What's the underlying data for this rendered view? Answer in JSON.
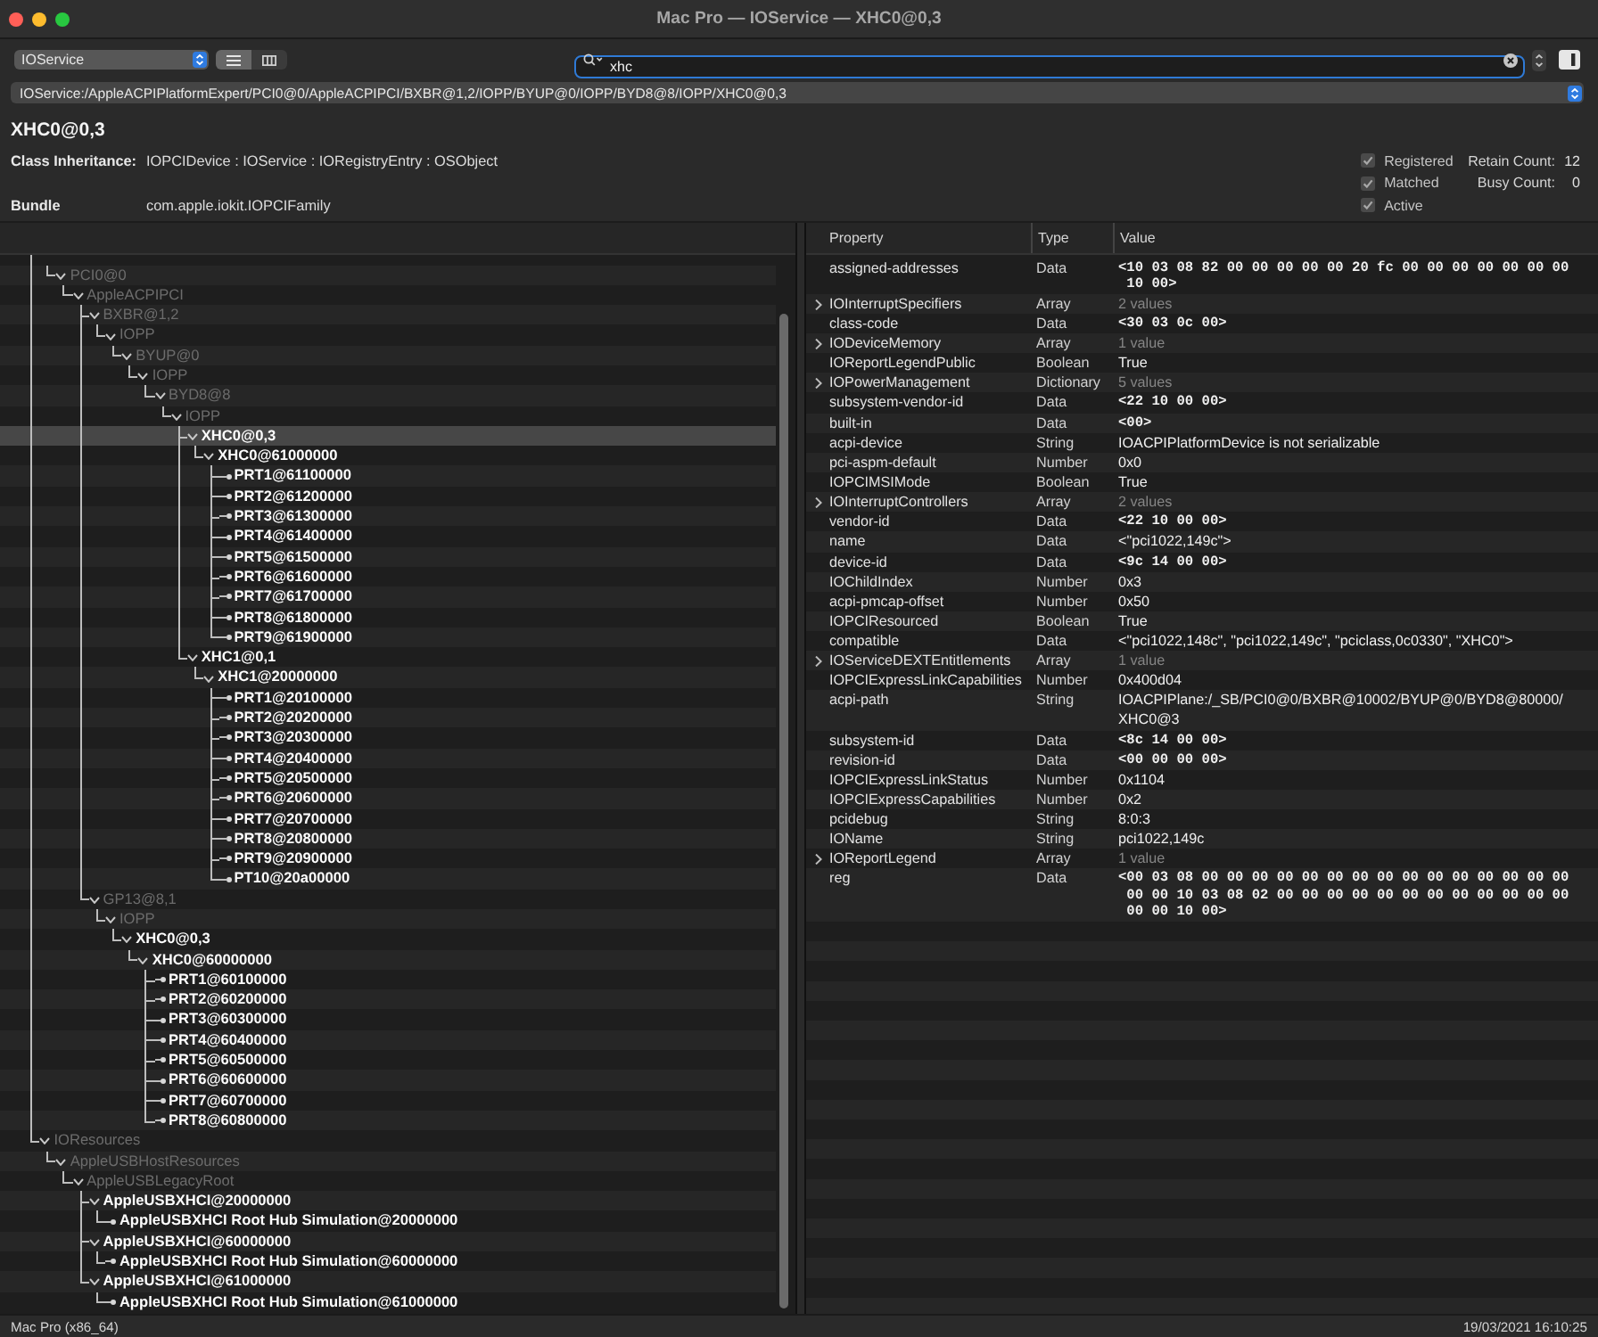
{
  "window": {
    "title": "Mac Pro — IOService — XHC0@0,3"
  },
  "toolbar": {
    "plane_popup": {
      "value": "IOService"
    },
    "view_modes": [
      {
        "kind": "list",
        "selected": true
      },
      {
        "kind": "columns",
        "selected": false
      }
    ],
    "search": {
      "value": "xhc",
      "focused": true
    }
  },
  "path_popup": {
    "value": "IOService:/AppleACPIPlatformExpert/PCI0@0/AppleACPIPCI/BXBR@1,2/IOPP/BYUP@0/IOPP/BYD8@8/IOPP/XHC0@0,3"
  },
  "object": {
    "name": "XHC0@0,3",
    "fields": [
      {
        "label": "Class Inheritance:",
        "value": "IOPCIDevice : IOService : IORegistryEntry : OSObject"
      },
      {
        "label": "Bundle",
        "value": "com.apple.iokit.IOPCIFamily"
      }
    ],
    "flags": [
      {
        "label": "Registered",
        "checked": true,
        "disabled": true
      },
      {
        "label": "Matched",
        "checked": true,
        "disabled": true
      },
      {
        "label": "Active",
        "checked": true,
        "disabled": true
      }
    ],
    "counts": [
      {
        "label": "Retain Count:",
        "value": "12"
      },
      {
        "label": "Busy Count:",
        "value": "0"
      }
    ]
  },
  "tree": {
    "nodes": [
      {
        "children": [
          {
            "label": "PCI0@0",
            "matched": false,
            "selected": false,
            "expanded": true,
            "children": [
              {
                "label": "AppleACPIPCI",
                "matched": false,
                "selected": false,
                "expanded": true,
                "children": [
                  {
                    "label": "BXBR@1,2",
                    "matched": false,
                    "selected": false,
                    "expanded": true,
                    "children": [
                      {
                        "label": "IOPP",
                        "matched": false,
                        "selected": false,
                        "expanded": true,
                        "children": [
                          {
                            "label": "BYUP@0",
                            "matched": false,
                            "selected": false,
                            "expanded": true,
                            "children": [
                              {
                                "label": "IOPP",
                                "matched": false,
                                "selected": false,
                                "expanded": true,
                                "children": [
                                  {
                                    "label": "BYD8@8",
                                    "matched": false,
                                    "selected": false,
                                    "expanded": true,
                                    "children": [
                                      {
                                        "label": "IOPP",
                                        "matched": false,
                                        "selected": false,
                                        "expanded": true,
                                        "children": [
                                          {
                                            "label": "XHC0@0,3",
                                            "matched": true,
                                            "selected": true,
                                            "expanded": true,
                                            "children": [
                                              {
                                                "label": "XHC0@61000000",
                                                "matched": true,
                                                "selected": false,
                                                "expanded": true,
                                                "children": [
                                                  {
                                                    "label": "PRT1@61100000",
                                                    "matched": true,
                                                    "selected": false
                                                  },
                                                  {
                                                    "label": "PRT2@61200000",
                                                    "matched": true,
                                                    "selected": false
                                                  },
                                                  {
                                                    "label": "PRT3@61300000",
                                                    "matched": true,
                                                    "selected": false
                                                  },
                                                  {
                                                    "label": "PRT4@61400000",
                                                    "matched": true,
                                                    "selected": false
                                                  },
                                                  {
                                                    "label": "PRT5@61500000",
                                                    "matched": true,
                                                    "selected": false
                                                  },
                                                  {
                                                    "label": "PRT6@61600000",
                                                    "matched": true,
                                                    "selected": false
                                                  },
                                                  {
                                                    "label": "PRT7@61700000",
                                                    "matched": true,
                                                    "selected": false
                                                  },
                                                  {
                                                    "label": "PRT8@61800000",
                                                    "matched": true,
                                                    "selected": false
                                                  },
                                                  {
                                                    "label": "PRT9@61900000",
                                                    "matched": true,
                                                    "selected": false
                                                  }
                                                ]
                                              }
                                            ]
                                          },
                                          {
                                            "label": "XHC1@0,1",
                                            "matched": true,
                                            "selected": false,
                                            "expanded": true,
                                            "children": [
                                              {
                                                "label": "XHC1@20000000",
                                                "matched": true,
                                                "selected": false,
                                                "expanded": true,
                                                "children": [
                                                  {
                                                    "label": "PRT1@20100000",
                                                    "matched": true,
                                                    "selected": false
                                                  },
                                                  {
                                                    "label": "PRT2@20200000",
                                                    "matched": true,
                                                    "selected": false
                                                  },
                                                  {
                                                    "label": "PRT3@20300000",
                                                    "matched": true,
                                                    "selected": false
                                                  },
                                                  {
                                                    "label": "PRT4@20400000",
                                                    "matched": true,
                                                    "selected": false
                                                  },
                                                  {
                                                    "label": "PRT5@20500000",
                                                    "matched": true,
                                                    "selected": false
                                                  },
                                                  {
                                                    "label": "PRT6@20600000",
                                                    "matched": true,
                                                    "selected": false
                                                  },
                                                  {
                                                    "label": "PRT7@20700000",
                                                    "matched": true,
                                                    "selected": false
                                                  },
                                                  {
                                                    "label": "PRT8@20800000",
                                                    "matched": true,
                                                    "selected": false
                                                  },
                                                  {
                                                    "label": "PRT9@20900000",
                                                    "matched": true,
                                                    "selected": false
                                                  },
                                                  {
                                                    "label": "PT10@20a00000",
                                                    "matched": true,
                                                    "selected": false
                                                  }
                                                ]
                                              }
                                            ]
                                          }
                                        ]
                                      }
                                    ]
                                  }
                                ]
                              }
                            ]
                          }
                        ]
                      }
                    ]
                  },
                  {
                    "label": "GP13@8,1",
                    "matched": false,
                    "selected": false,
                    "expanded": true,
                    "children": [
                      {
                        "label": "IOPP",
                        "matched": false,
                        "selected": false,
                        "expanded": true,
                        "children": [
                          {
                            "label": "XHC0@0,3",
                            "matched": true,
                            "selected": false,
                            "expanded": true,
                            "children": [
                              {
                                "label": "XHC0@60000000",
                                "matched": true,
                                "selected": false,
                                "expanded": true,
                                "children": [
                                  {
                                    "label": "PRT1@60100000",
                                    "matched": true,
                                    "selected": false
                                  },
                                  {
                                    "label": "PRT2@60200000",
                                    "matched": true,
                                    "selected": false
                                  },
                                  {
                                    "label": "PRT3@60300000",
                                    "matched": true,
                                    "selected": false
                                  },
                                  {
                                    "label": "PRT4@60400000",
                                    "matched": true,
                                    "selected": false
                                  },
                                  {
                                    "label": "PRT5@60500000",
                                    "matched": true,
                                    "selected": false
                                  },
                                  {
                                    "label": "PRT6@60600000",
                                    "matched": true,
                                    "selected": false
                                  },
                                  {
                                    "label": "PRT7@60700000",
                                    "matched": true,
                                    "selected": false
                                  },
                                  {
                                    "label": "PRT8@60800000",
                                    "matched": true,
                                    "selected": false
                                  }
                                ]
                              }
                            ]
                          }
                        ]
                      }
                    ]
                  }
                ]
              }
            ]
          }
        ]
      },
      {
        "label": "IOResources",
        "matched": false,
        "selected": false,
        "expanded": true,
        "children": [
          {
            "label": "AppleUSBHostResources",
            "matched": false,
            "selected": false,
            "expanded": true,
            "children": [
              {
                "label": "AppleUSBLegacyRoot",
                "matched": false,
                "selected": false,
                "expanded": true,
                "children": [
                  {
                    "label": "AppleUSBXHCI@20000000",
                    "matched": true,
                    "selected": false,
                    "expanded": true,
                    "children": [
                      {
                        "label": "AppleUSBXHCI Root Hub Simulation@20000000",
                        "matched": true,
                        "selected": false
                      }
                    ]
                  },
                  {
                    "label": "AppleUSBXHCI@60000000",
                    "matched": true,
                    "selected": false,
                    "expanded": true,
                    "children": [
                      {
                        "label": "AppleUSBXHCI Root Hub Simulation@60000000",
                        "matched": true,
                        "selected": false
                      }
                    ]
                  },
                  {
                    "label": "AppleUSBXHCI@61000000",
                    "matched": true,
                    "selected": false,
                    "expanded": true,
                    "children": [
                      {
                        "label": "AppleUSBXHCI Root Hub Simulation@61000000",
                        "matched": true,
                        "selected": false
                      }
                    ]
                  }
                ]
              }
            ]
          }
        ]
      }
    ]
  },
  "properties": {
    "columns": [
      "Property",
      "Type",
      "Value"
    ],
    "rows": [
      {
        "property": "assigned-addresses",
        "type": "Data",
        "value": "<10 03 08 82 00 00 00 00 00 20 fc 00 00 00 00 00 00 00 10 00>",
        "kind": "data"
      },
      {
        "property": "IOInterruptSpecifiers",
        "type": "Array",
        "value": "2 values",
        "kind": "collection",
        "expanded": false
      },
      {
        "property": "class-code",
        "type": "Data",
        "value": "<30 03 0c 00>",
        "kind": "data"
      },
      {
        "property": "IODeviceMemory",
        "type": "Array",
        "value": "1 value",
        "kind": "collection",
        "expanded": false
      },
      {
        "property": "IOReportLegendPublic",
        "type": "Boolean",
        "value": "True",
        "kind": "text"
      },
      {
        "property": "IOPowerManagement",
        "type": "Dictionary",
        "value": "5 values",
        "kind": "collection",
        "expanded": false
      },
      {
        "property": "subsystem-vendor-id",
        "type": "Data",
        "value": "<22 10 00 00>",
        "kind": "data"
      },
      {
        "property": "built-in",
        "type": "Data",
        "value": "<00>",
        "kind": "data"
      },
      {
        "property": "acpi-device",
        "type": "String",
        "value": "IOACPIPlatformDevice is not serializable",
        "kind": "text"
      },
      {
        "property": "pci-aspm-default",
        "type": "Number",
        "value": "0x0",
        "kind": "text"
      },
      {
        "property": "IOPCIMSIMode",
        "type": "Boolean",
        "value": "True",
        "kind": "text"
      },
      {
        "property": "IOInterruptControllers",
        "type": "Array",
        "value": "2 values",
        "kind": "collection",
        "expanded": false
      },
      {
        "property": "vendor-id",
        "type": "Data",
        "value": "<22 10 00 00>",
        "kind": "data"
      },
      {
        "property": "name",
        "type": "Data",
        "value": "<\"pci1022,149c\">",
        "kind": "text"
      },
      {
        "property": "device-id",
        "type": "Data",
        "value": "<9c 14 00 00>",
        "kind": "data"
      },
      {
        "property": "IOChildIndex",
        "type": "Number",
        "value": "0x3",
        "kind": "text"
      },
      {
        "property": "acpi-pmcap-offset",
        "type": "Number",
        "value": "0x50",
        "kind": "text"
      },
      {
        "property": "IOPCIResourced",
        "type": "Boolean",
        "value": "True",
        "kind": "text"
      },
      {
        "property": "compatible",
        "type": "Data",
        "value": "<\"pci1022,148c\", \"pci1022,149c\", \"pciclass,0c0330\", \"XHC0\">",
        "kind": "text"
      },
      {
        "property": "IOServiceDEXTEntitlements",
        "type": "Array",
        "value": "1 value",
        "kind": "collection",
        "expanded": false
      },
      {
        "property": "IOPCIExpressLinkCapabilities",
        "type": "Number",
        "value": "0x400d04",
        "kind": "text"
      },
      {
        "property": "acpi-path",
        "type": "String",
        "value": "IOACPIPlane:/_SB/PCI0@0/BXBR@10002/BYUP@0/BYD8@80000/XHC0@3",
        "kind": "text"
      },
      {
        "property": "subsystem-id",
        "type": "Data",
        "value": "<8c 14 00 00>",
        "kind": "data"
      },
      {
        "property": "revision-id",
        "type": "Data",
        "value": "<00 00 00 00>",
        "kind": "data"
      },
      {
        "property": "IOPCIExpressLinkStatus",
        "type": "Number",
        "value": "0x1104",
        "kind": "text"
      },
      {
        "property": "IOPCIExpressCapabilities",
        "type": "Number",
        "value": "0x2",
        "kind": "text"
      },
      {
        "property": "pcidebug",
        "type": "String",
        "value": "8:0:3",
        "kind": "text"
      },
      {
        "property": "IOName",
        "type": "String",
        "value": "pci1022,149c",
        "kind": "text"
      },
      {
        "property": "IOReportLegend",
        "type": "Array",
        "value": "1 value",
        "kind": "collection",
        "expanded": false
      },
      {
        "property": "reg",
        "type": "Data",
        "value": "<00 03 08 00 00 00 00 00 00 00 00 00 00 00 00 00 00 00 00 00 10 03 08 02 00 00 00 00 00 00 00 00 00 00 00 00 00 00 10 00>",
        "kind": "data"
      }
    ]
  },
  "status_bar": {
    "machine": "Mac Pro (x86_64)",
    "timestamp": "19/03/2021 16:10:25"
  }
}
